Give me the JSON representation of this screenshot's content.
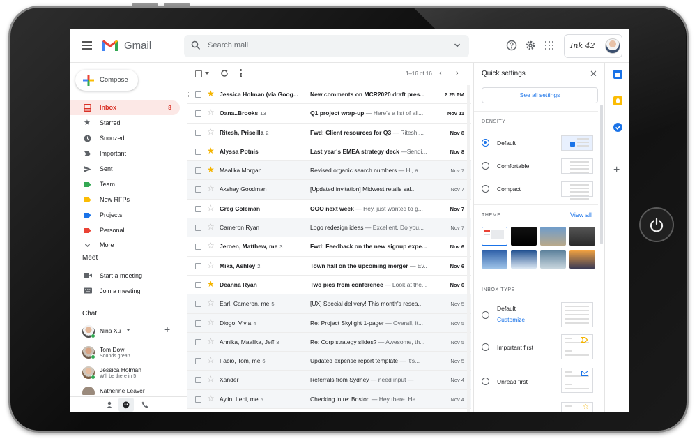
{
  "app": {
    "name": "Gmail",
    "account_logo_text": "Ink 42"
  },
  "search": {
    "placeholder": "Search mail"
  },
  "sidebar": {
    "compose_label": "Compose",
    "items": [
      {
        "label": "Inbox",
        "count": "8",
        "icon": "inbox-icon",
        "color": "#d93025",
        "active": true
      },
      {
        "label": "Starred",
        "icon": "star-icon",
        "color": "#5f6368"
      },
      {
        "label": "Snoozed",
        "icon": "clock-icon",
        "color": "#5f6368"
      },
      {
        "label": "Important",
        "icon": "important-icon",
        "color": "#5f6368"
      },
      {
        "label": "Sent",
        "icon": "send-icon",
        "color": "#5f6368"
      },
      {
        "label": "Team",
        "icon": "label-icon",
        "color": "#34a853"
      },
      {
        "label": "New RFPs",
        "icon": "label-icon",
        "color": "#fbbc04"
      },
      {
        "label": "Projects",
        "icon": "label-icon",
        "color": "#1a73e8"
      },
      {
        "label": "Personal",
        "icon": "label-icon",
        "color": "#ea4335"
      },
      {
        "label": "More",
        "icon": "chevron-down-icon",
        "color": "#5f6368"
      }
    ],
    "meet": {
      "title": "Meet",
      "items": [
        {
          "label": "Start a meeting",
          "icon": "video-icon"
        },
        {
          "label": "Join a meeting",
          "icon": "keyboard-icon"
        }
      ]
    },
    "chat": {
      "title": "Chat",
      "me": "Nina Xu",
      "contacts": [
        {
          "name": "Tom Dow",
          "status": "Sounds great!"
        },
        {
          "name": "Jessica Holman",
          "status": "Will be there in 5"
        },
        {
          "name": "Katherine Leaver",
          "status": ""
        }
      ]
    }
  },
  "toolbar": {
    "range": "1–16 of 16",
    "prev": "‹",
    "next": "›"
  },
  "emails": [
    {
      "sender": "Jessica Holman (via Goog...",
      "count": "",
      "subject": "New comments on MCR2020 draft pres...",
      "snippet": "",
      "date": "2:25 PM",
      "starred": true,
      "unread": true
    },
    {
      "sender": "Oana..Brooks",
      "count": "13",
      "subject": "Q1 project wrap-up",
      "snippet": " — Here's a list of all...",
      "date": "Nov 11",
      "starred": false,
      "unread": true
    },
    {
      "sender": "Ritesh, Priscilla",
      "count": "2",
      "subject": "Fwd: Client resources for Q3",
      "snippet": " — Ritesh,...",
      "date": "Nov 8",
      "starred": false,
      "unread": true
    },
    {
      "sender": "Alyssa Potnis",
      "count": "",
      "subject": "Last year's EMEA strategy deck",
      "snippet": " —Sendi...",
      "date": "Nov 8",
      "starred": true,
      "unread": true
    },
    {
      "sender": "Maalika Morgan",
      "count": "",
      "subject": "Revised organic search numbers",
      "snippet": " — Hi, a...",
      "date": "Nov 7",
      "starred": true,
      "unread": false
    },
    {
      "sender": "Akshay Goodman",
      "count": "",
      "subject": "[Updated invitation] Midwest retails sal...",
      "snippet": "",
      "date": "Nov 7",
      "starred": false,
      "unread": false
    },
    {
      "sender": "Greg Coleman",
      "count": "",
      "subject": "OOO next week",
      "snippet": " — Hey, just wanted to g...",
      "date": "Nov 7",
      "starred": false,
      "unread": true
    },
    {
      "sender": "Cameron Ryan",
      "count": "",
      "subject": "Logo redesign ideas",
      "snippet": " — Excellent. Do you...",
      "date": "Nov 7",
      "starred": false,
      "unread": false
    },
    {
      "sender": "Jeroen, Matthew, me",
      "count": "3",
      "subject": "Fwd: Feedback on the new signup expe...",
      "snippet": "",
      "date": "Nov 6",
      "starred": false,
      "unread": true
    },
    {
      "sender": "Mika, Ashley",
      "count": "2",
      "subject": "Town hall on the upcoming merger",
      "snippet": " — Ev...",
      "date": "Nov 6",
      "starred": false,
      "unread": true
    },
    {
      "sender": "Deanna Ryan",
      "count": "",
      "subject": "Two pics from conference",
      "snippet": " — Look at the...",
      "date": "Nov 6",
      "starred": true,
      "unread": true
    },
    {
      "sender": "Earl, Cameron, me",
      "count": "5",
      "subject": "[UX] Special delivery! This month's resea...",
      "snippet": "",
      "date": "Nov 5",
      "starred": false,
      "unread": false
    },
    {
      "sender": "Diogo, Vivia",
      "count": "4",
      "subject": "Re: Project Skylight 1-pager",
      "snippet": " — Overall, it...",
      "date": "Nov 5",
      "starred": false,
      "unread": false
    },
    {
      "sender": "Annika, Maalika, Jeff",
      "count": "3",
      "subject": "Re: Corp strategy slides?",
      "snippet": " — Awesome, th...",
      "date": "Nov 5",
      "starred": false,
      "unread": false
    },
    {
      "sender": "Fabio, Tom, me",
      "count": "6",
      "subject": "Updated expense report template",
      "snippet": " — It's...",
      "date": "Nov 5",
      "starred": false,
      "unread": false
    },
    {
      "sender": "Xander",
      "count": "",
      "subject": "Referrals from Sydney",
      "snippet": " — need input —",
      "date": "Nov 4",
      "starred": false,
      "unread": false
    },
    {
      "sender": "Aylin, Leni, me",
      "count": "5",
      "subject": "Checking in re: Boston",
      "snippet": " — Hey there. He...",
      "date": "Nov 4",
      "starred": false,
      "unread": false
    }
  ],
  "quick_settings": {
    "title": "Quick settings",
    "see_all": "See all settings",
    "density": {
      "title": "DENSITY",
      "options": [
        "Default",
        "Comfortable",
        "Compact"
      ],
      "selected": "Default"
    },
    "theme": {
      "title": "THEME",
      "view_all": "View all",
      "swatches": [
        {
          "name": "default-theme",
          "colors": [
            "#ffffff",
            "#e8eaed"
          ]
        },
        {
          "name": "dark-theme",
          "colors": [
            "#111111",
            "#000000"
          ]
        },
        {
          "name": "beach-theme",
          "colors": [
            "#6e9ccc",
            "#b9a98a"
          ]
        },
        {
          "name": "pebbles-theme",
          "colors": [
            "#555555",
            "#2a2a2a"
          ]
        },
        {
          "name": "lake-theme",
          "colors": [
            "#2d5fa8",
            "#9ec3e8"
          ]
        },
        {
          "name": "mountain-theme",
          "colors": [
            "#1f4e8f",
            "#dbe7f3"
          ]
        },
        {
          "name": "coast-theme",
          "colors": [
            "#5a7f9a",
            "#c8d6de"
          ]
        },
        {
          "name": "sunset-theme",
          "colors": [
            "#f4a340",
            "#3b3b55"
          ]
        }
      ]
    },
    "inbox_type": {
      "title": "INBOX TYPE",
      "options": [
        "Default",
        "Important first",
        "Unread first"
      ],
      "customize": "Customize"
    }
  },
  "colors": {
    "accent": "#1a73e8",
    "inbox_red": "#d93025",
    "star": "#f4b400"
  }
}
